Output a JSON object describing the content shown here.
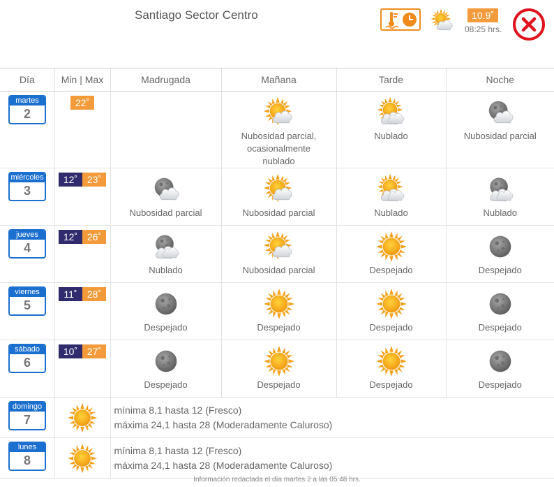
{
  "header": {
    "city": "Santiago Sector Centro",
    "current_temp": "10.9˚",
    "current_time": "08:25 hrs."
  },
  "table": {
    "headers": [
      "Día",
      "Min | Max",
      "Madrugada",
      "Mañana",
      "Tarde",
      "Noche"
    ]
  },
  "days": [
    {
      "name": "martes",
      "num": "2",
      "max": "22˚",
      "madrugada": {
        "icon": "none",
        "label": ""
      },
      "manana": {
        "icon": "sun-cloud",
        "label": "Nubosidad parcial, ocasionalmente nublado"
      },
      "tarde": {
        "icon": "sun-cloud-heavy",
        "label": "Nublado"
      },
      "noche": {
        "icon": "moon-cloud",
        "label": "Nubosidad parcial"
      }
    },
    {
      "name": "miércoles",
      "num": "3",
      "min": "12˚",
      "max": "23˚",
      "madrugada": {
        "icon": "moon-cloud",
        "label": "Nubosidad parcial"
      },
      "manana": {
        "icon": "sun-cloud",
        "label": "Nubosidad parcial"
      },
      "tarde": {
        "icon": "sun-cloud-heavy",
        "label": "Nublado"
      },
      "noche": {
        "icon": "moon-cloud-heavy",
        "label": "Nublado"
      }
    },
    {
      "name": "jueves",
      "num": "4",
      "min": "12˚",
      "max": "26˚",
      "madrugada": {
        "icon": "moon-cloud-heavy",
        "label": "Nublado"
      },
      "manana": {
        "icon": "sun-cloud",
        "label": "Nubosidad parcial"
      },
      "tarde": {
        "icon": "sun",
        "label": "Despejado"
      },
      "noche": {
        "icon": "moon",
        "label": "Despejado"
      }
    },
    {
      "name": "viernes",
      "num": "5",
      "min": "11˚",
      "max": "28˚",
      "madrugada": {
        "icon": "moon",
        "label": "Despejado"
      },
      "manana": {
        "icon": "sun",
        "label": "Despejado"
      },
      "tarde": {
        "icon": "sun",
        "label": "Despejado"
      },
      "noche": {
        "icon": "moon",
        "label": "Despejado"
      }
    },
    {
      "name": "sábado",
      "num": "6",
      "min": "10˚",
      "max": "27˚",
      "madrugada": {
        "icon": "moon",
        "label": "Despejado"
      },
      "manana": {
        "icon": "sun",
        "label": "Despejado"
      },
      "tarde": {
        "icon": "sun",
        "label": "Despejado"
      },
      "noche": {
        "icon": "moon",
        "label": "Despejado"
      }
    }
  ],
  "extended": [
    {
      "name": "domingo",
      "num": "7",
      "icon": "sun",
      "line1": "mínima 8,1 hasta 12 (Fresco)",
      "line2": "máxima 24,1 hasta 28 (Moderadamente Caluroso)"
    },
    {
      "name": "lunes",
      "num": "8",
      "icon": "sun",
      "line1": "mínima 8,1 hasta 12 (Fresco)",
      "line2": "máxima 24,1 hasta 28 (Moderadamente Caluroso)"
    }
  ],
  "footer": "Información redactada el día martes 2 a las 05:48 hrs.",
  "colors": {
    "accent_blue": "#1b6fcf",
    "min_bg": "#2f2b6d",
    "max_bg": "#f39a3a",
    "close_red": "#e0141e"
  }
}
